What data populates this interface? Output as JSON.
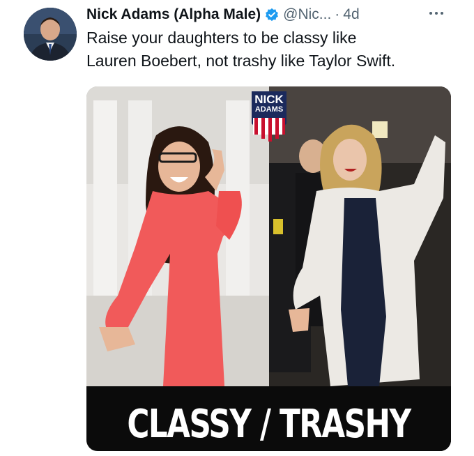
{
  "tweet": {
    "author_name": "Nick Adams (Alpha Male)",
    "handle": "@Nic...",
    "separator": "·",
    "time": "4d",
    "text_line1": "Raise your daughters to be classy like",
    "text_line2": "Lauren Boebert, not trashy like Taylor Swift."
  },
  "media": {
    "caption": "CLASSY / TRASHY",
    "logo_line1": "NICK",
    "logo_line2": "ADAMS"
  },
  "icons": {
    "verified": "verified-badge-icon",
    "more": "more-options-icon"
  },
  "colors": {
    "verified_blue": "#1d9bf0",
    "text_primary": "#0f1419",
    "text_secondary": "#536471",
    "logo_red": "#c8102e",
    "logo_blue": "#1b2a5c"
  }
}
